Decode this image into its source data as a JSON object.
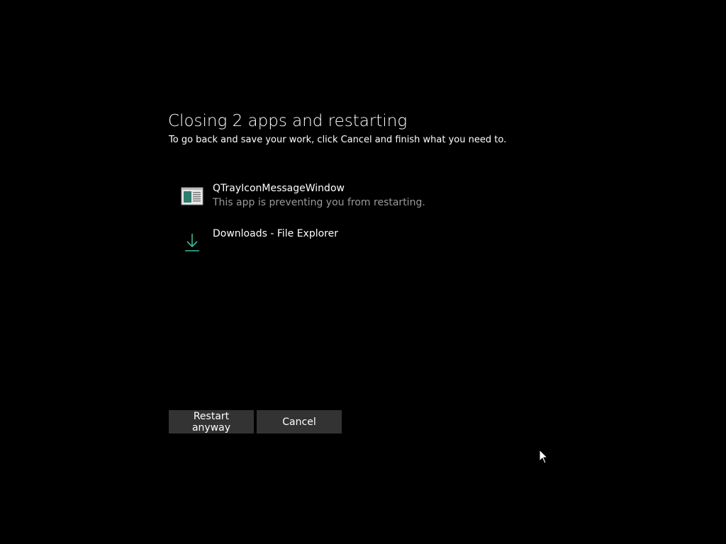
{
  "dialog": {
    "title": "Closing 2 apps and restarting",
    "subtitle": "To go back and save your work, click Cancel and finish what you need to."
  },
  "apps": [
    {
      "name": "QTrayIconMessageWindow",
      "status": "This app is preventing you from restarting.",
      "icon": "app-window-icon"
    },
    {
      "name": "Downloads - File Explorer",
      "status": "",
      "icon": "download-icon"
    }
  ],
  "buttons": {
    "restart_label": "Restart anyway",
    "cancel_label": "Cancel"
  },
  "colors": {
    "background": "#000000",
    "button_bg": "#333333",
    "secondary_text": "#9a9a9a",
    "download_icon": "#3fb89a"
  },
  "cursor": "mouse-pointer-icon"
}
